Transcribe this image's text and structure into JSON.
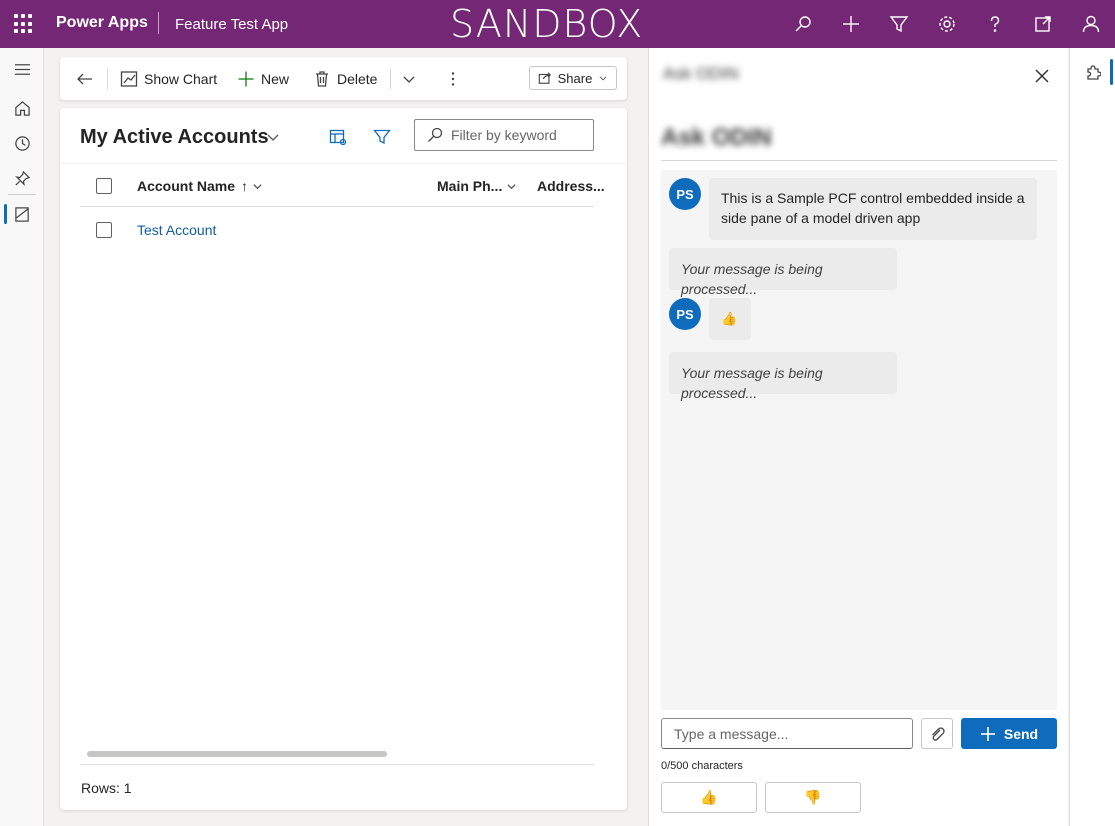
{
  "topbar": {
    "brand": "Power Apps",
    "app_name": "Feature Test App",
    "environment_label": "SANDBOX",
    "icons": [
      "search-icon",
      "plus-icon",
      "filter-icon",
      "gear-icon",
      "help-icon",
      "popout-icon",
      "person-icon"
    ],
    "color": "#742774"
  },
  "leftnav": {
    "icons": [
      "hamburger-icon",
      "home-icon",
      "recent-icon",
      "pin-icon",
      "entity-icon"
    ]
  },
  "commandbar": {
    "show_chart": "Show Chart",
    "new": "New",
    "delete": "Delete",
    "share": "Share"
  },
  "grid": {
    "view_title": "My Active Accounts",
    "filter_placeholder": "Filter by keyword",
    "columns": [
      "Account Name",
      "Main Ph...",
      "Address..."
    ],
    "sort_indicator": "↑",
    "rows": [
      {
        "account_name": "Test Account"
      }
    ],
    "rows_label": "Rows: 1"
  },
  "sidepane": {
    "header_blurred": "Ask ODIN",
    "title_blurred": "Ask ODIN",
    "messages": [
      {
        "type": "user",
        "initials": "PS",
        "text": "This is a Sample PCF control embedded inside a side pane of a model driven app"
      },
      {
        "type": "status",
        "text": "Your message is being processed..."
      },
      {
        "type": "user",
        "initials": "PS",
        "text": "👍"
      },
      {
        "type": "status",
        "text": "Your message is being processed..."
      }
    ],
    "input_placeholder": "Type a message...",
    "send_label": "Send",
    "char_count": "0/500 characters",
    "thumbs_up": "👍",
    "thumbs_down": "👎",
    "accent": "#0f6cbd"
  },
  "rightrail": {
    "icons": [
      "puzzle-icon"
    ]
  }
}
